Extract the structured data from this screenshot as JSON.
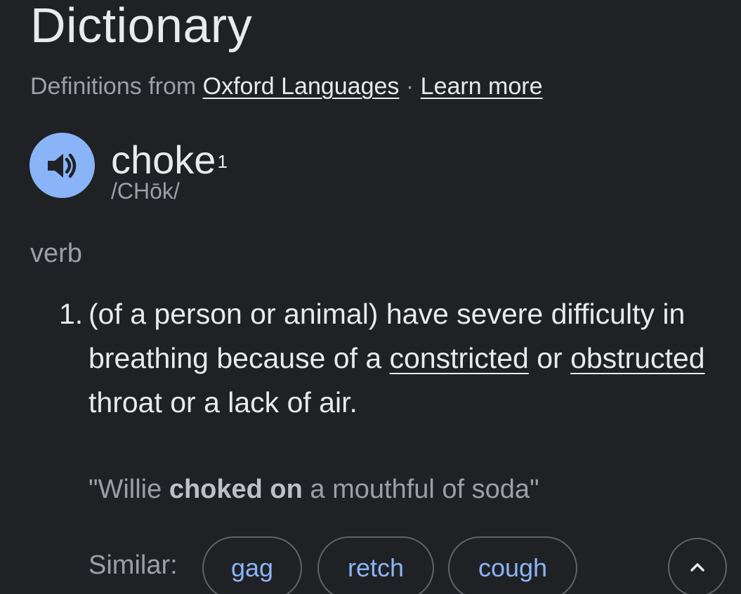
{
  "header": {
    "title": "Dictionary",
    "source_prefix": "Definitions from",
    "source_link": "Oxford Languages",
    "separator": "·",
    "learn_more": "Learn more"
  },
  "entry": {
    "word": "choke",
    "homograph_number": "1",
    "phonetic": "/CHōk/",
    "audio_icon": "speaker-icon",
    "part_of_speech": "verb",
    "definitions": [
      {
        "number": "1.",
        "text_start": "(of a person or animal) have severe difficulty in breathing because of a ",
        "link1": "constricted",
        "text_mid": " or ",
        "link2": "obstructed",
        "text_end": " throat or a lack of air.",
        "example_open": "\"Willie ",
        "example_bold": "choked on",
        "example_close": " a mouthful of soda\""
      }
    ],
    "similar_label": "Similar:",
    "similar": [
      "gag",
      "retch",
      "cough"
    ],
    "collapse_icon": "chevron-up-icon"
  },
  "colors": {
    "background": "#202124",
    "accent": "#8ab4f8",
    "text": "#e8eaed",
    "muted": "#9aa0a6",
    "border": "#5f6368"
  }
}
